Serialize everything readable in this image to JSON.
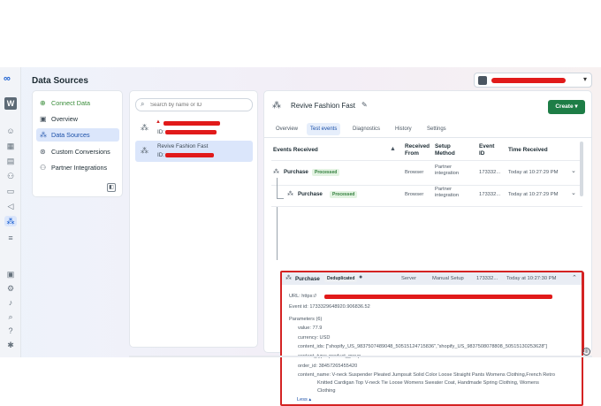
{
  "page": {
    "title": "Data Sources"
  },
  "rail": {
    "logo": "∞",
    "avatar": "W",
    "icons": [
      "smiley-icon",
      "grid-icon",
      "document-icon",
      "people-icon",
      "card-icon",
      "megaphone-icon",
      "data-sources-icon",
      "menu-icon",
      "page-icon",
      "settings-icon",
      "bell-icon",
      "search-icon",
      "help-icon",
      "bug-icon"
    ]
  },
  "nav": {
    "items": [
      {
        "label": "Connect Data",
        "icon": "plus-circle-icon"
      },
      {
        "label": "Overview",
        "icon": "overview-icon"
      },
      {
        "label": "Data Sources",
        "icon": "data-sources-icon"
      },
      {
        "label": "Custom Conversions",
        "icon": "conversions-icon"
      },
      {
        "label": "Partner Integrations",
        "icon": "partner-icon"
      }
    ]
  },
  "search": {
    "placeholder": "Search by name or ID"
  },
  "sources": [
    {
      "name": "",
      "id_label": "ID:"
    },
    {
      "name": "Revive Fashion Fast",
      "id_label": "ID:"
    }
  ],
  "panel": {
    "title": "Revive Fashion Fast",
    "create_label": "Create",
    "tabs": [
      "Overview",
      "Test events",
      "Diagnostics",
      "History",
      "Settings"
    ],
    "active_tab": "Test events",
    "columns": {
      "events": "Events Received",
      "received_from": [
        "Received",
        "From"
      ],
      "setup_method": [
        "Setup",
        "Method"
      ],
      "event_id": [
        "Event",
        "ID"
      ],
      "time": "Time Received"
    },
    "rows": [
      {
        "event": "Purchase",
        "badge": "Processed",
        "from": "Browser",
        "setup": [
          "Partner",
          "integration"
        ],
        "id": "173332...",
        "time": "Today at 10:27:29 PM"
      },
      {
        "event": "Purchase",
        "badge": "Processed",
        "from": "Browser",
        "setup": [
          "Partner",
          "integration"
        ],
        "id": "173332...",
        "time": "Today at 10:27:29 PM"
      },
      {
        "event": "Purchase",
        "badge": "Deduplicated",
        "from": "Server",
        "setup": [
          "Manual Setup"
        ],
        "id": "173332...",
        "time": "Today at 10:27:30 PM"
      }
    ],
    "details": {
      "url_label": "URL: https://",
      "event_id": "Event id: 1733329648920.906836.52",
      "parameters": "Parameters (6)",
      "value": "value:  77.9",
      "currency": "currency:  USD",
      "content_ids": "content_ids:  [\"shopify_US_9837507489048_50515124715836\",\"shopify_US_9837508078808_50515130253628\"]",
      "content_type": "content_type:  product_group",
      "order_id": "order_id:  38457265455420",
      "content_name_1": "content_name:  V-neck Suspender Pleated Jumpsuit Solid Color Loose Straight Pants Womens Clothing,French Retro",
      "content_name_2": "Knitted Cardigan Top V-neck Tie Loose Womens Sweater Coat, Handmade Spring Clothing, Womens",
      "content_name_3": "Clothing",
      "less": "Less ▴"
    }
  },
  "colors": {
    "accent": "#1a5fd0",
    "create": "#1d7d46",
    "highlight": "#d42323",
    "redaction": "#e11a1a"
  }
}
